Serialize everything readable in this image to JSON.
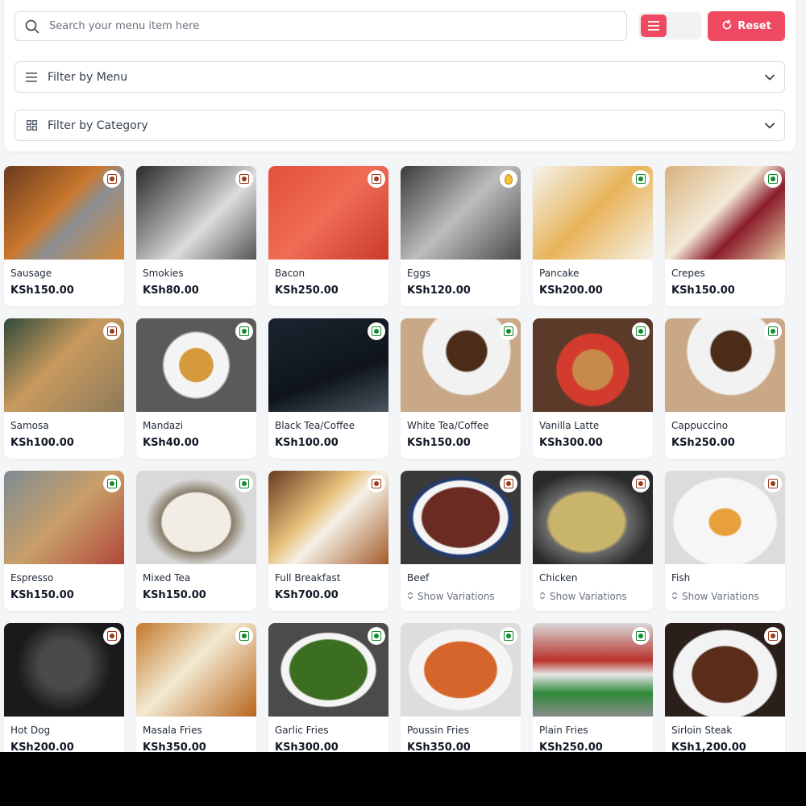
{
  "search": {
    "placeholder": "Search your menu item here"
  },
  "toolbar": {
    "reset_label": "Reset"
  },
  "filters": {
    "menu_label": "Filter by Menu",
    "category_label": "Filter by Category"
  },
  "variations_label": "Show Variations",
  "colors": {
    "accent": "#f04a63",
    "veg": "#138a2c",
    "nonveg": "#9a3b1c",
    "egg": "#f6c23e"
  },
  "items": [
    {
      "name": "Sausage",
      "price": "KSh150.00",
      "diet": "nonveg",
      "icon": "sausage-photo",
      "bg": "linear-gradient(135deg,#6b3a1e,#c9782e 45%,#8c8f93 60%,#d48a3a)"
    },
    {
      "name": "Smokies",
      "price": "KSh80.00",
      "diet": "nonveg",
      "icon": "train-photo",
      "bg": "linear-gradient(135deg,#2a2a2a,#9a9a9a 40%,#dcdcdc 60%,#555)"
    },
    {
      "name": "Bacon",
      "price": "KSh250.00",
      "diet": "nonveg",
      "icon": "watermelon-photo",
      "bg": "linear-gradient(135deg,#e2503c,#f06c55 50%,#c93a2c)"
    },
    {
      "name": "Eggs",
      "price": "KSh120.00",
      "diet": "egg",
      "icon": "banquet-photo",
      "bg": "linear-gradient(135deg,#3a3a3a,#bdbdbd 50%,#4a4a4a)"
    },
    {
      "name": "Pancake",
      "price": "KSh200.00",
      "diet": "veg",
      "icon": "pancake-photo",
      "bg": "linear-gradient(135deg,#f5f3ef,#e8b45a 50%,#f6f2ea)"
    },
    {
      "name": "Crepes",
      "price": "KSh150.00",
      "diet": "veg",
      "icon": "crepe-dessert-photo",
      "bg": "linear-gradient(135deg,#d9b27c,#f3ead8 45%,#8a1c2a 65%,#e6cfa6)"
    },
    {
      "name": "Samosa",
      "price": "KSh100.00",
      "diet": "nonveg",
      "icon": "samosa-photo",
      "bg": "linear-gradient(135deg,#2e4a3a,#c89a5e 45%,#8d7a5a)"
    },
    {
      "name": "Mandazi",
      "price": "KSh40.00",
      "diet": "veg",
      "icon": "mandazi-photo",
      "bg": "radial-gradient(circle at 50% 50%,#d49a3c 0 22%,#f4f4f4 23% 42%,#5a5a5a 45%)"
    },
    {
      "name": "Black Tea/Coffee",
      "price": "KSh100.00",
      "diet": "veg",
      "icon": "black-tea-photo",
      "bg": "linear-gradient(160deg,#1b2530,#0e141a 60%,#4b5560)"
    },
    {
      "name": "White Tea/Coffee",
      "price": "KSh150.00",
      "diet": "veg",
      "icon": "white-coffee-photo",
      "bg": "radial-gradient(circle at 55% 35%,#4a2c18 0 22%,#f2f2f2 24% 48%,#c9a887 50%)"
    },
    {
      "name": "Vanilla Latte",
      "price": "KSh300.00",
      "diet": "veg",
      "icon": "latte-photo",
      "bg": "radial-gradient(circle at 50% 55%,#c88a4a 0 25%,#d23b2e 27% 45%,#5b3a2a 47%)"
    },
    {
      "name": "Cappuccino",
      "price": "KSh250.00",
      "diet": "veg",
      "icon": "cappuccino-photo",
      "bg": "radial-gradient(circle at 55% 35%,#4a2c18 0 22%,#f2f2f2 24% 48%,#c9a887 50%)"
    },
    {
      "name": "Espresso",
      "price": "KSh150.00",
      "diet": "veg",
      "icon": "espresso-laptop-photo",
      "bg": "linear-gradient(135deg,#7d8a92,#c9a06a 50%,#b0463a)"
    },
    {
      "name": "Mixed Tea",
      "price": "KSh150.00",
      "diet": "veg",
      "icon": "tea-bowl-photo",
      "bg": "radial-gradient(ellipse at 50% 55%,#f1ede4 0 40%,#8a7f6c 42%,#d9d9d9 60%)"
    },
    {
      "name": "Full Breakfast",
      "price": "KSh700.00",
      "diet": "nonveg",
      "icon": "full-breakfast-photo",
      "bg": "linear-gradient(135deg,#6a3a22,#e6c07a 40%,#f5f0e6 55%,#a35b2c)"
    },
    {
      "name": "Beef",
      "variations": true,
      "diet": "nonveg",
      "icon": "beef-photo",
      "bg": "radial-gradient(ellipse at 50% 50%,#6b2a22 0 45%,#f4f4f4 47% 55%,#1d3a7a 57%,#3a3a3a 64%)"
    },
    {
      "name": "Chicken",
      "variations": true,
      "diet": "nonveg",
      "icon": "chicken-curry-photo",
      "bg": "radial-gradient(ellipse at 45% 55%,#c8b46a 0 40%,#6a6a6a 44%,#2a2a2a 70%)"
    },
    {
      "name": "Fish",
      "variations": true,
      "diet": "nonveg",
      "icon": "fish-dish-photo",
      "bg": "radial-gradient(ellipse at 50% 55%,#e8a03a 0 18%,#f6f6f6 20% 60%,#dcdcdc 62%)"
    },
    {
      "name": "Hot Dog",
      "price": "KSh200.00",
      "diet": "nonveg",
      "icon": "insect-photo",
      "bg": "radial-gradient(circle at 50% 45%,#4a4a4a 0 30%,#1a1a1a 60%)"
    },
    {
      "name": "Masala Fries",
      "price": "KSh350.00",
      "diet": "veg",
      "icon": "masala-fries-photo",
      "bg": "linear-gradient(135deg,#c2772a,#f3ead2 45%,#b8641e)"
    },
    {
      "name": "Garlic Fries",
      "price": "KSh300.00",
      "diet": "veg",
      "icon": "green-beans-photo",
      "bg": "radial-gradient(ellipse at 50% 50%,#3c6e22 0 45%,#f4f4f4 47% 55%,#4b4b4b 57%)"
    },
    {
      "name": "Poussin Fries",
      "price": "KSh350.00",
      "diet": "veg",
      "icon": "pasta-photo",
      "bg": "radial-gradient(ellipse at 50% 50%,#d5652a 0 42%,#f5f5f5 44% 60%,#dddddd 62%)"
    },
    {
      "name": "Plain Fries",
      "price": "KSh250.00",
      "diet": "veg",
      "icon": "fries-stand-photo",
      "bg": "linear-gradient(180deg,#d8d8d8,#b8322a 40%,#e6e6e6 55%,#2e8a3a 75%,#8a8a8a)"
    },
    {
      "name": "Sirloin Steak",
      "price": "KSh1,200.00",
      "diet": "nonveg",
      "icon": "steak-photo",
      "bg": "radial-gradient(ellipse at 50% 55%,#5a2c1a 0 38%,#f3f3f3 40% 60%,#2a1f1a 62%)"
    }
  ]
}
